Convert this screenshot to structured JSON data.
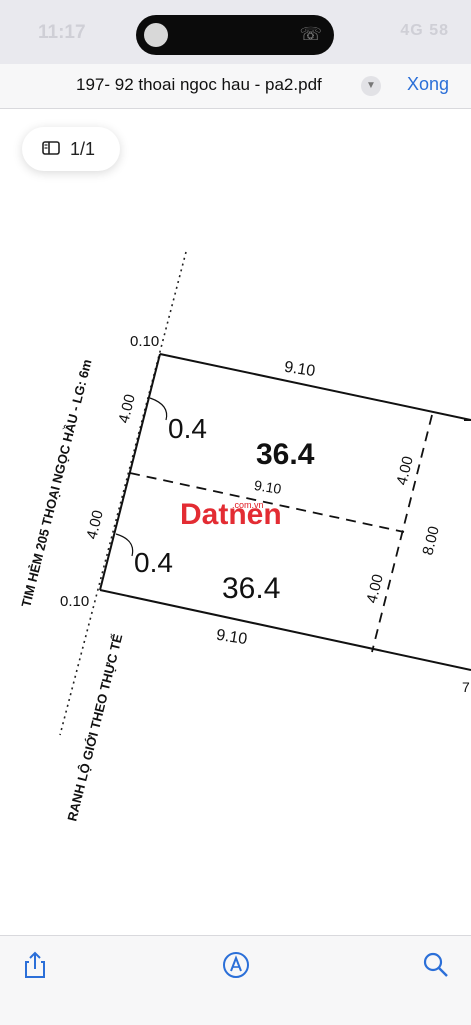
{
  "status_bar": {
    "time": "11:17",
    "right_text": "4G 58"
  },
  "nav": {
    "document_title": "197- 92 thoai ngoc hau - pa2.pdf",
    "done_label": "Xong"
  },
  "page_indicator": {
    "text": "1/1"
  },
  "drawing": {
    "top_left_offset": "0.10",
    "bottom_left_offset": "0.10",
    "top_width": "9.10",
    "middle_width": "9.10",
    "bottom_width": "9.10",
    "left_upper_depth": "4.00",
    "left_lower_depth": "4.00",
    "right_upper_depth": "4.00",
    "right_lower_depth": "4.00",
    "total_depth": "8.00",
    "upper_corner_area": "0.4",
    "upper_area": "36.4",
    "lower_corner_area": "0.4",
    "lower_area": "36.4",
    "street_label": "TIM HẺM 205 THOẠI NGỌC HẦU - LG: 6m",
    "boundary_label": "RANH LỘ GIỚI THEO THỰC TẾ",
    "watermark": "Datnen",
    "watermark_sub": ".com.vn",
    "edge_mark": "7"
  },
  "colors": {
    "accent": "#2b6fd8",
    "watermark": "#e11b22"
  },
  "toolbar": {
    "icons": [
      "share-icon",
      "markup-icon",
      "search-icon"
    ]
  }
}
